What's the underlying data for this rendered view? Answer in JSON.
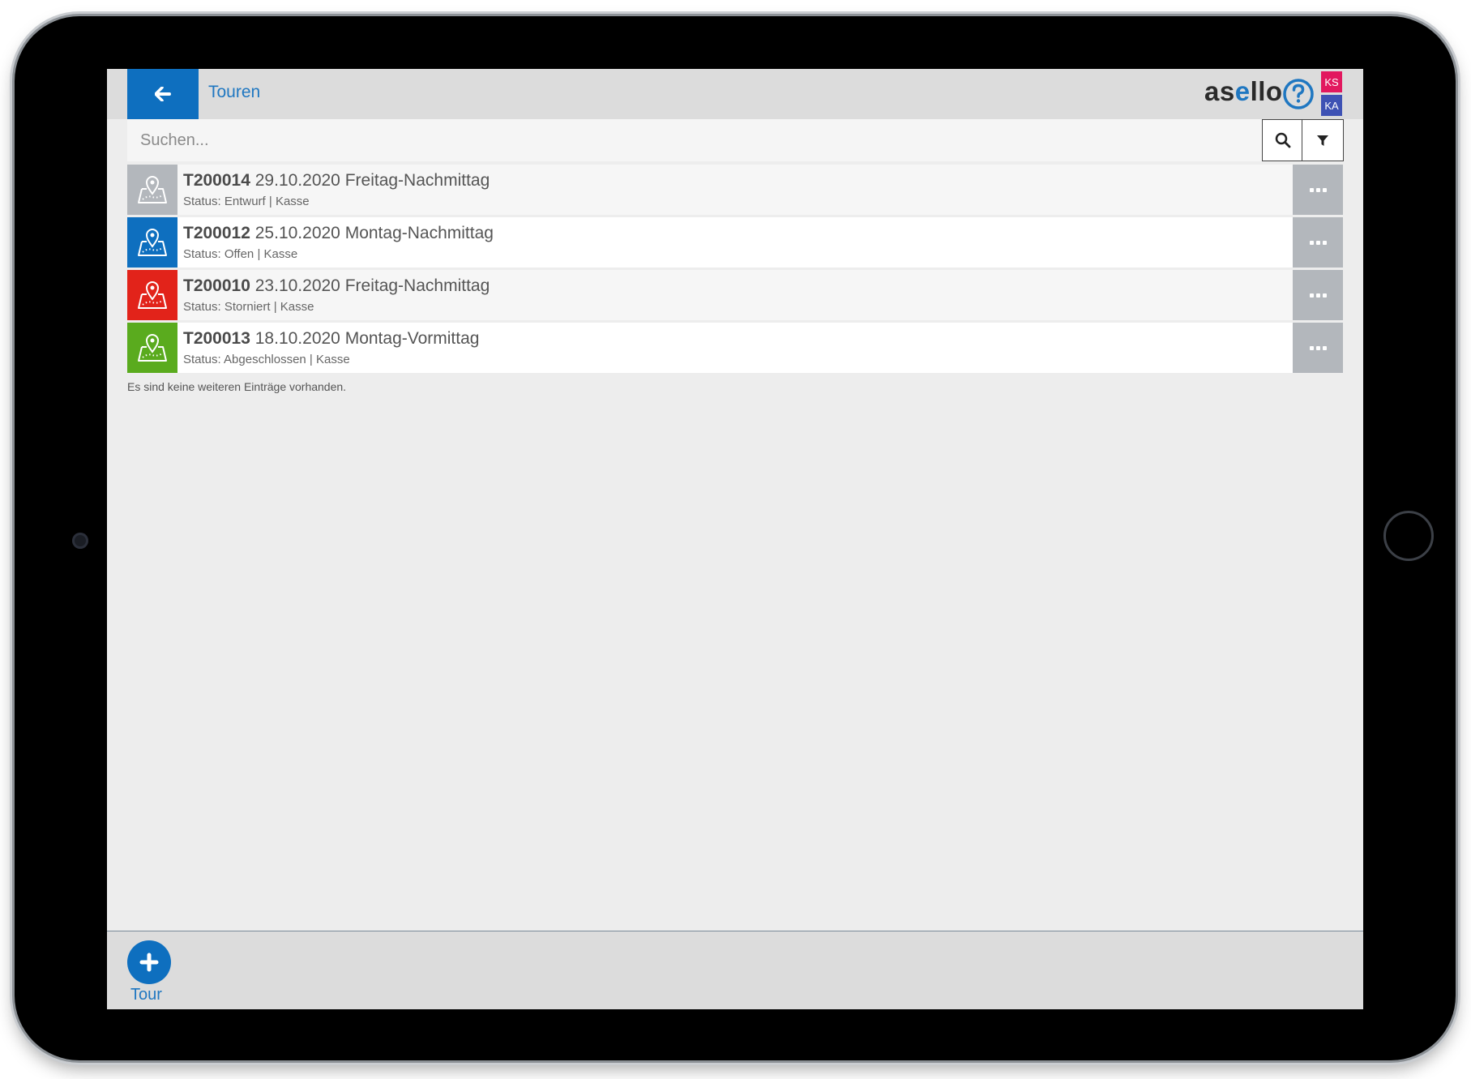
{
  "header": {
    "title": "Touren",
    "brand_prefix": "as",
    "brand_accent": "e",
    "brand_suffix": "llo",
    "user_badges": [
      "KS",
      "KA"
    ]
  },
  "search": {
    "placeholder": "Suchen..."
  },
  "tours": [
    {
      "id": "T200014",
      "date": "29.10.2020",
      "name": "Freitag-Nachmittag",
      "status_line": "Status: Entwurf | Kasse",
      "status_color": "#b3b7bc"
    },
    {
      "id": "T200012",
      "date": "25.10.2020",
      "name": "Montag-Nachmittag",
      "status_line": "Status: Offen | Kasse",
      "status_color": "#0e6fbf"
    },
    {
      "id": "T200010",
      "date": "23.10.2020",
      "name": "Freitag-Nachmittag",
      "status_line": "Status: Storniert | Kasse",
      "status_color": "#e2231a"
    },
    {
      "id": "T200013",
      "date": "18.10.2020",
      "name": "Montag-Vormittag",
      "status_line": "Status: Abgeschlossen | Kasse",
      "status_color": "#5aab1e"
    }
  ],
  "list_end_note": "Es sind keine weiteren Einträge vorhanden.",
  "footer": {
    "add_label": "Tour"
  },
  "colors": {
    "accent": "#0e6fbf",
    "badge_ks": "#e2185f",
    "badge_ka": "#3e52b4"
  },
  "icons": [
    "arrow-left-icon",
    "help-icon",
    "search-icon",
    "filter-icon",
    "map-pin-icon",
    "more-icon",
    "plus-icon"
  ]
}
